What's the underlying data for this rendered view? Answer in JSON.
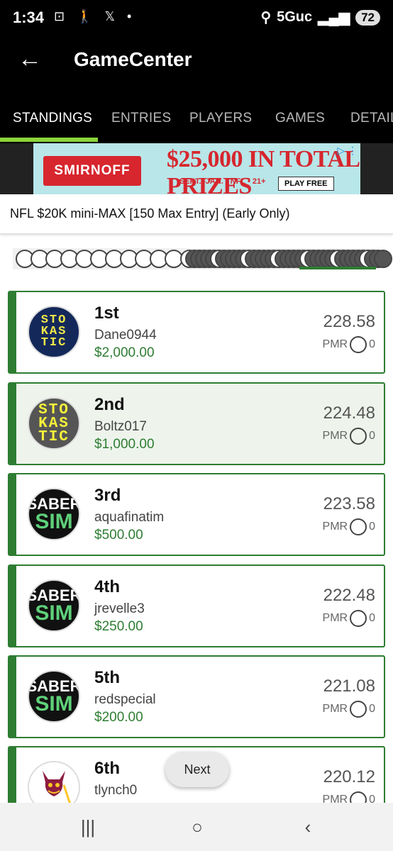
{
  "status": {
    "time": "1:34",
    "left_icons": "⊡ 🚶 𝕏 •",
    "network": "5Guc",
    "battery": "72"
  },
  "app_bar": {
    "title": "GameCenter"
  },
  "tabs": [
    {
      "label": "STANDINGS",
      "active": true
    },
    {
      "label": "ENTRIES",
      "active": false
    },
    {
      "label": "PLAYERS",
      "active": false
    },
    {
      "label": "GAMES",
      "active": false
    },
    {
      "label": "DETAIL",
      "active": false
    }
  ],
  "ad": {
    "brand": "SMIRNOFF",
    "headline": "$25,000 IN TOTAL PRIZES",
    "subline": "SEPT.–JAN. • NFL • 21+",
    "cta": "PLAY FREE"
  },
  "contest": {
    "name": "NFL $20K mini-MAX [150 Max Entry] (Early Only)"
  },
  "standings": [
    {
      "rank": "1st",
      "user": "Dane0944",
      "prize": "$2,000.00",
      "score": "228.58",
      "pmr_label": "PMR",
      "pmr": "0",
      "avatar": "stokastic"
    },
    {
      "rank": "2nd",
      "user": "Boltz017",
      "prize": "$1,000.00",
      "score": "224.48",
      "pmr_label": "PMR",
      "pmr": "0",
      "avatar": "stokastic-grey"
    },
    {
      "rank": "3rd",
      "user": "aquafinatim",
      "prize": "$500.00",
      "score": "223.58",
      "pmr_label": "PMR",
      "pmr": "0",
      "avatar": "sabersim"
    },
    {
      "rank": "4th",
      "user": "jrevelle3",
      "prize": "$250.00",
      "score": "222.48",
      "pmr_label": "PMR",
      "pmr": "0",
      "avatar": "sabersim"
    },
    {
      "rank": "5th",
      "user": "redspecial",
      "prize": "$200.00",
      "score": "221.08",
      "pmr_label": "PMR",
      "pmr": "0",
      "avatar": "sabersim"
    },
    {
      "rank": "6th",
      "user": "tlynch0",
      "prize": "",
      "score": "220.12",
      "pmr_label": "PMR",
      "pmr": "0",
      "avatar": "devil"
    }
  ],
  "avatar_text": {
    "stokastic": [
      "STO",
      "KAS",
      "TIC"
    ],
    "saber_top": "SABER",
    "saber_bottom": "SIM"
  },
  "next_label": "Next",
  "nav": {
    "recents": "|||",
    "home": "○",
    "back": "‹"
  }
}
